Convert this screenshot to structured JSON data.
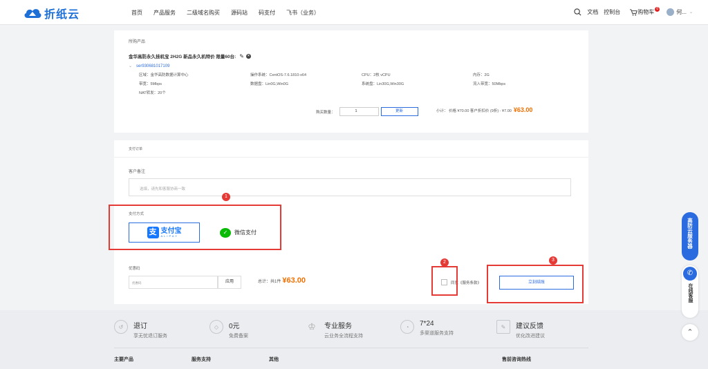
{
  "brand": {
    "name": "折纸云"
  },
  "nav": [
    "首页",
    "产品服务",
    "二级域名购买",
    "源码站",
    "码支付",
    "飞书（业务）"
  ],
  "header_right": {
    "docs": "文档",
    "console": "控制台",
    "cart": "购物车",
    "cart_count": "0",
    "user": "何..."
  },
  "product_section": {
    "title": "所购产品",
    "product_name": "金华高防永久挂机宝 2H2G 新品永久机特价 限量60台:",
    "server_id": "ser930681017109",
    "specs": [
      [
        "区域：金华高防数据计算中心",
        "操作系统：CentOS-7.6.1810-x64",
        "CPU：2核 vCPU",
        "内存：2G"
      ],
      [
        "带宽：5Mbps",
        "数据盘：Lin0G,Win0G",
        "系统盘：Lin30G,Win30G",
        "流入带宽：50Mbps"
      ],
      [
        "NAT转发：20个",
        "",
        "",
        ""
      ]
    ],
    "qty_label": "购买数量：",
    "qty_value": "1",
    "update_btn": "更新",
    "subtotal_text": "小计：  价格 ¥70.00   客户折扣价 (9折) - ¥7.00",
    "subtotal_value": "¥63.00"
  },
  "payment_section": {
    "title": "支付订单",
    "remark_label": "客户备注",
    "remark_placeholder": "选填，请先和客服协商一致",
    "method_label": "支付方式",
    "alipay_cn": "支付宝",
    "alipay_en": "ALIPAY",
    "wechat": "微信支付",
    "coupon_label": "优惠码",
    "coupon_placeholder": "优惠码",
    "apply_btn": "应用",
    "total_label": "总计：共1件",
    "total_value": "¥63.00",
    "agree_text": "同意《服务条款》",
    "pay_btn": "立刻结账"
  },
  "annotations": [
    "1",
    "2",
    "3"
  ],
  "footer": {
    "features": [
      {
        "icon": "return-icon",
        "title": "退订",
        "sub": "享无忧退订服务"
      },
      {
        "icon": "shield-icon",
        "title": "0元",
        "sub": "免费备案"
      },
      {
        "icon": "crown-icon",
        "title": "专业服务",
        "sub": "云业务全流程支持"
      },
      {
        "icon": "clock-icon",
        "title": "7*24",
        "sub": "多渠道服务支持"
      },
      {
        "icon": "feedback-icon",
        "title": "建议反馈",
        "sub": "优化改进建议"
      }
    ],
    "cols": [
      "主要产品",
      "服务支持",
      "其他",
      "售前咨询热线"
    ]
  },
  "side": {
    "ddos": "高防云服务器",
    "online": "在线客服"
  },
  "colors": {
    "accent": "#2b6be0",
    "price": "#f06f00",
    "alert": "#e53935",
    "alipay": "#1677ff",
    "wechat": "#09bb07"
  }
}
